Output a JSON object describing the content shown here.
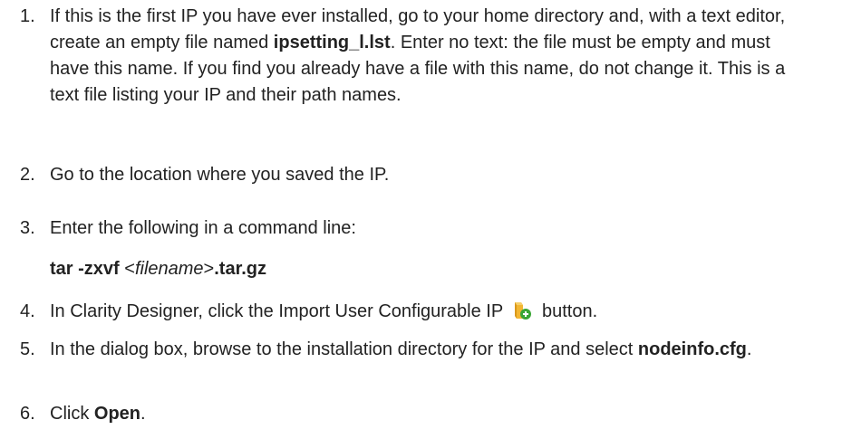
{
  "steps": [
    {
      "number": "1.",
      "t1": "If this is the first IP you have ever installed, go to your home directory and, with a text editor, create an empty file named ",
      "filename": "ipsetting_l.lst",
      "t2": ". Enter no text: the file must be empty and must have this name. If you find you already have a file with this name, do not change it. This is a text file listing your IP and their path names."
    },
    {
      "number": "2.",
      "text": "Go to the location where you saved the IP."
    },
    {
      "number": "3.",
      "text": "Enter the following in a command line:"
    },
    {
      "number": "4.",
      "t1": "In Clarity Designer, click the Import User Configurable IP",
      "icon": "import-ip-icon",
      "t2": "button."
    },
    {
      "number": "5.",
      "t1": "In the dialog box, browse to the installation directory for the IP and select ",
      "bold": "nodeinfo.cfg",
      "t2": "."
    },
    {
      "number": "6.",
      "t1": "Click ",
      "bold": "Open",
      "t2": "."
    }
  ],
  "command": {
    "prefix": "tar -zxvf ",
    "lt": "<",
    "placeholder": "filename",
    "gt": ">",
    "suffix": ".tar.gz"
  },
  "colors": {
    "text": "#222222",
    "icon_folder": "#f2b632",
    "icon_plus": "#3aa635"
  }
}
